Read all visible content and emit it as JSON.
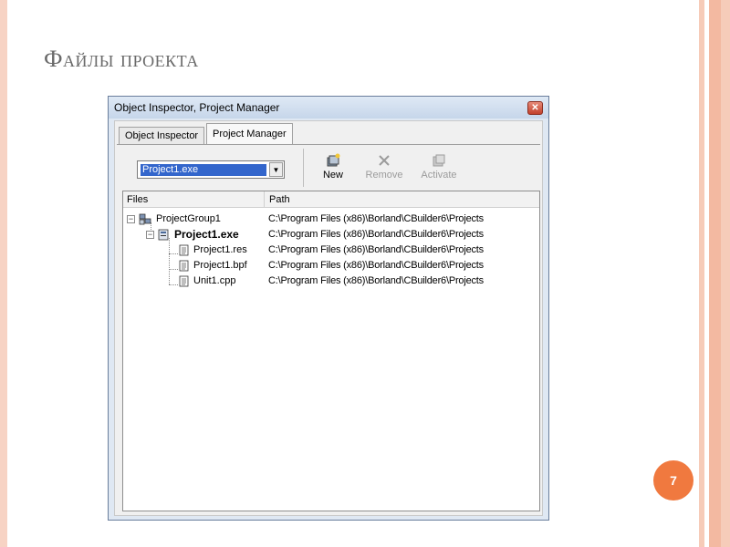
{
  "slide": {
    "title": "Файлы проекта",
    "page_number": "7"
  },
  "window": {
    "title": "Object Inspector, Project Manager",
    "close_glyph": "✕",
    "tabs": [
      {
        "label": "Object Inspector",
        "active": false
      },
      {
        "label": "Project Manager",
        "active": true
      }
    ],
    "combo": {
      "value": "Project1.exe",
      "arrow": "▼"
    },
    "toolbar": {
      "new_label": "New",
      "remove_label": "Remove",
      "activate_label": "Activate",
      "new_icon": "new-project-icon",
      "remove_icon": "remove-icon",
      "activate_icon": "activate-icon"
    },
    "list": {
      "columns": [
        "Files",
        "Path"
      ],
      "rows": [
        {
          "name": "ProjectGroup1",
          "path": "C:\\Program Files (x86)\\Borland\\CBuilder6\\Projects"
        },
        {
          "name": "Project1.exe",
          "path": "C:\\Program Files (x86)\\Borland\\CBuilder6\\Projects"
        },
        {
          "name": "Project1.res",
          "path": "C:\\Program Files (x86)\\Borland\\CBuilder6\\Projects"
        },
        {
          "name": "Project1.bpf",
          "path": "C:\\Program Files (x86)\\Borland\\CBuilder6\\Projects"
        },
        {
          "name": "Unit1.cpp",
          "path": "C:\\Program Files (x86)\\Borland\\CBuilder6\\Projects"
        }
      ]
    }
  },
  "colors": {
    "accent_circle": "#f0793f",
    "selection": "#3366cc"
  }
}
